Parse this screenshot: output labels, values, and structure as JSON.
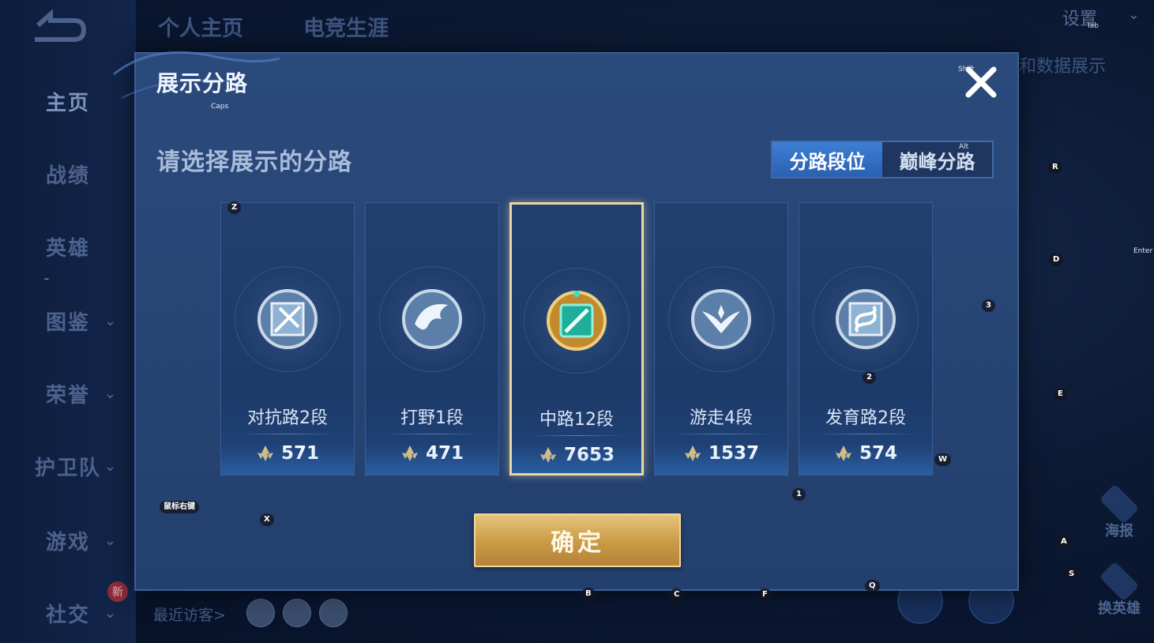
{
  "background": {
    "top_tabs": [
      "个人主页",
      "电竞生涯"
    ],
    "settings_label": "设置",
    "tab_key": "Tab",
    "behind_label": "和数据展示",
    "sidebar": [
      {
        "label": "主页",
        "active": true
      },
      {
        "label": "战绩"
      },
      {
        "label": "英雄"
      },
      {
        "label": "图鉴",
        "expandable": true
      },
      {
        "label": "荣誉",
        "expandable": true
      },
      {
        "label": "护卫队",
        "expandable": true
      },
      {
        "label": "游戏",
        "expandable": true
      },
      {
        "label": "社交",
        "expandable": true
      }
    ],
    "new_badge": "新",
    "recent_visitors_label": "最近访客>",
    "right_buttons": [
      "海报",
      "换英雄"
    ]
  },
  "modal": {
    "title": "展示分路",
    "subtitle": "请选择展示的分路",
    "segmented": {
      "options": [
        "分路段位",
        "巅峰分路"
      ],
      "selected": 0
    },
    "cards": [
      {
        "name": "对抗路2段",
        "score": "571",
        "icon": "sword-badge-icon",
        "selected": false
      },
      {
        "name": "打野1段",
        "score": "471",
        "icon": "dragon-badge-icon",
        "selected": false
      },
      {
        "name": "中路12段",
        "score": "7653",
        "icon": "staff-badge-icon",
        "selected": true
      },
      {
        "name": "游走4段",
        "score": "1537",
        "icon": "wings-badge-icon",
        "selected": false
      },
      {
        "name": "发育路2段",
        "score": "574",
        "icon": "arrow-badge-icon",
        "selected": false
      }
    ],
    "confirm_label": "确定"
  },
  "key_hints": {
    "caps": "Caps",
    "shift": "Shift",
    "alt": "Alt",
    "tab": "Tab",
    "enter": "Enter",
    "mouse_right": "鼠标右键",
    "tilde": "~",
    "z": "Z",
    "x": "X",
    "r": "R",
    "d": "D",
    "e": "E",
    "three": "3",
    "two": "2",
    "one": "1",
    "w": "W",
    "a": "A",
    "s": "S",
    "b": "B",
    "c": "C",
    "f": "F",
    "q": "Q"
  },
  "colors": {
    "accent_blue": "#3d7fd4",
    "gold": "#d6ad5c",
    "selected_border": "#e9d7a4",
    "modal_bg": "#26446f"
  }
}
